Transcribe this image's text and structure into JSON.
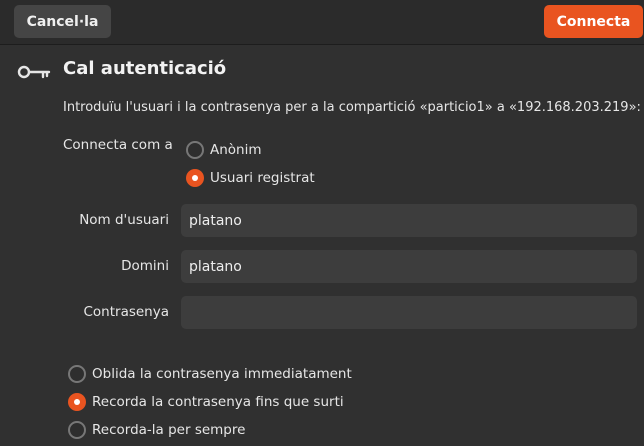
{
  "header": {
    "cancel_label": "Cancel·la",
    "connect_label": "Connecta"
  },
  "dialog": {
    "icon": "key-icon",
    "title": "Cal autenticació",
    "description": "Introduïu l'usuari i la contrasenya per a la compartició «particio1» a «192.168.203.219»:"
  },
  "connect_as": {
    "label": "Connecta com a",
    "options": [
      {
        "label": "Anònim",
        "checked": false
      },
      {
        "label": "Usuari registrat",
        "checked": true
      }
    ]
  },
  "fields": {
    "username": {
      "label": "Nom d'usuari",
      "value": "platano"
    },
    "domain": {
      "label": "Domini",
      "value": "platano"
    },
    "password": {
      "label": "Contrasenya",
      "value": ""
    }
  },
  "remember": {
    "options": [
      {
        "label": "Oblida la contrasenya immediatament",
        "checked": false
      },
      {
        "label": "Recorda la contrasenya fins que surti",
        "checked": true
      },
      {
        "label": "Recorda-la per sempre",
        "checked": false
      }
    ]
  },
  "colors": {
    "accent": "#e95420",
    "background": "#303030",
    "headerbar": "#2b2b2b"
  }
}
